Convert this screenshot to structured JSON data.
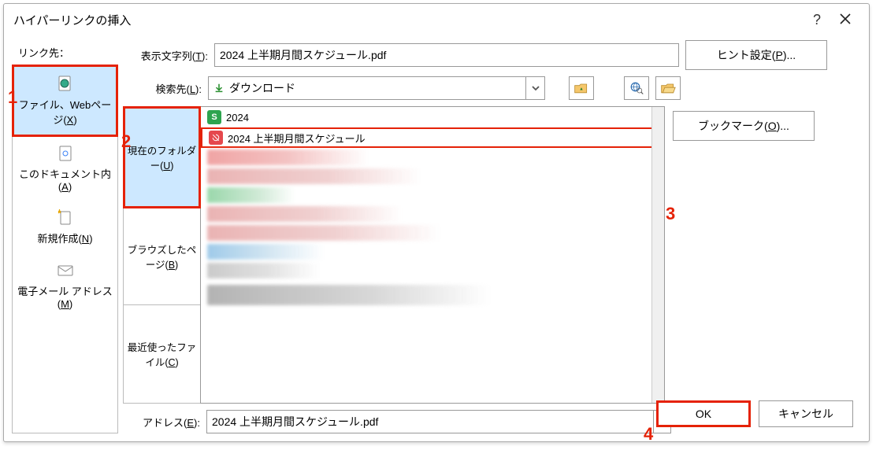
{
  "dialog": {
    "title": "ハイパーリンクの挿入"
  },
  "labels": {
    "link_to": "リンク先：",
    "display_text": "表示文字列(T):",
    "look_in": "検索先(L):",
    "address": "アドレス(E):"
  },
  "inputs": {
    "display_text": "2024 上半期月間スケジュール.pdf",
    "look_in": "ダウンロード",
    "address": "2024 上半期月間スケジュール.pdf"
  },
  "sidebar": {
    "items": [
      {
        "label": "ファイル、Webページ(X)",
        "active": true
      },
      {
        "label": "このドキュメント内(A)",
        "active": false
      },
      {
        "label": "新規作成(N)",
        "active": false
      },
      {
        "label": "電子メール アドレス(M)",
        "active": false
      }
    ]
  },
  "browse_tabs": {
    "items": [
      {
        "label": "現在のフォルダー(U)",
        "active": true
      },
      {
        "label": "ブラウズしたページ(B)",
        "active": false
      },
      {
        "label": "最近使ったファイル(C)",
        "active": false
      }
    ]
  },
  "files": [
    {
      "name": "2024",
      "icon": "green",
      "selected": false
    },
    {
      "name": "2024 上半期月間スケジュール",
      "icon": "red",
      "selected": true
    }
  ],
  "right_buttons": {
    "hint": "ヒント設定(P)...",
    "bookmark": "ブックマーク(O)..."
  },
  "footer": {
    "ok": "OK",
    "cancel": "キャンセル"
  },
  "callouts": {
    "c1": "1",
    "c2": "2",
    "c3": "3",
    "c4": "4"
  }
}
